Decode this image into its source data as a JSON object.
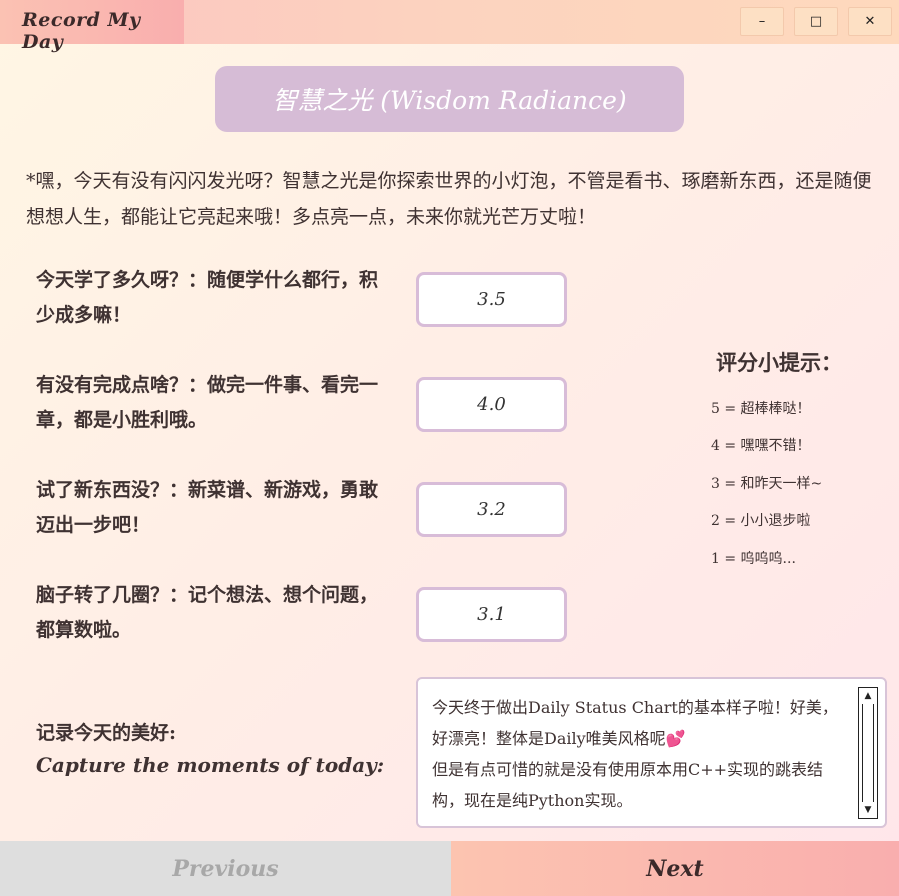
{
  "window": {
    "title": "Record My Day",
    "controls": {
      "minimize": "–",
      "maximize": "□",
      "close": "✕"
    }
  },
  "header": {
    "title": "智慧之光 (Wisdom Radiance)"
  },
  "intro": "*嘿，今天有没有闪闪发光呀？智慧之光是你探索世界的小灯泡，不管是看书、琢磨新东西，还是随便想想人生，都能让它亮起来哦！多点亮一点，未来你就光芒万丈啦！",
  "questions": [
    {
      "label": "今天学了多久呀？：随便学什么都行，积少成多嘛！",
      "value": "3.5"
    },
    {
      "label": "有没有完成点啥？：做完一件事、看完一章，都是小胜利哦。",
      "value": "4.0"
    },
    {
      "label": "试了新东西没？：新菜谱、新游戏，勇敢迈出一步吧！",
      "value": "3.2"
    },
    {
      "label": "脑子转了几圈？：记个想法、想个问题，都算数啦。",
      "value": "3.1"
    }
  ],
  "hints": {
    "title": "评分小提示：",
    "items": [
      "5 = 超棒棒哒！",
      "4 = 嘿嘿不错！",
      "3 = 和昨天一样~",
      "2 = 小小退步啦",
      "1 = 呜呜呜..."
    ]
  },
  "record": {
    "label": "记录今天的美好:",
    "sublabel": "Capture the moments of today:",
    "text": "今天终于做出Daily Status Chart的基本样子啦！好美，好漂亮！整体是Daily唯美风格呢💕\n但是有点可惜的就是没有使用原本用C++实现的跳表结构，现在是纯Python实现。"
  },
  "nav": {
    "previous": "Previous",
    "next": "Next"
  }
}
